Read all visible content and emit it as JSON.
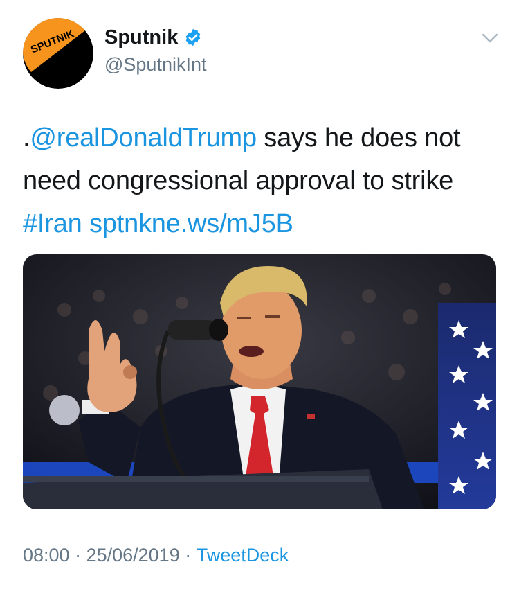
{
  "author": {
    "display_name": "Sputnik",
    "handle": "@SputnikInt",
    "avatar_logo_text": "SPUTNIK",
    "verified": true
  },
  "tweet": {
    "prefix": ".",
    "mention": "@realDonaldTrump",
    "text_main": " says he does not need congressional approval to strike ",
    "hashtag": "#Iran",
    "space": " ",
    "url": "sptnkne.ws/mJ5B"
  },
  "meta": {
    "time": "08:00",
    "sep1": " · ",
    "date": "25/06/2019",
    "sep2": " · ",
    "source": "TweetDeck"
  },
  "icons": {
    "verified": "verified-badge-icon",
    "menu": "chevron-down-icon"
  },
  "colors": {
    "link": "#1b95e0",
    "secondary_text": "#657786",
    "avatar_orange": "#f7941d",
    "avatar_black": "#000000"
  }
}
